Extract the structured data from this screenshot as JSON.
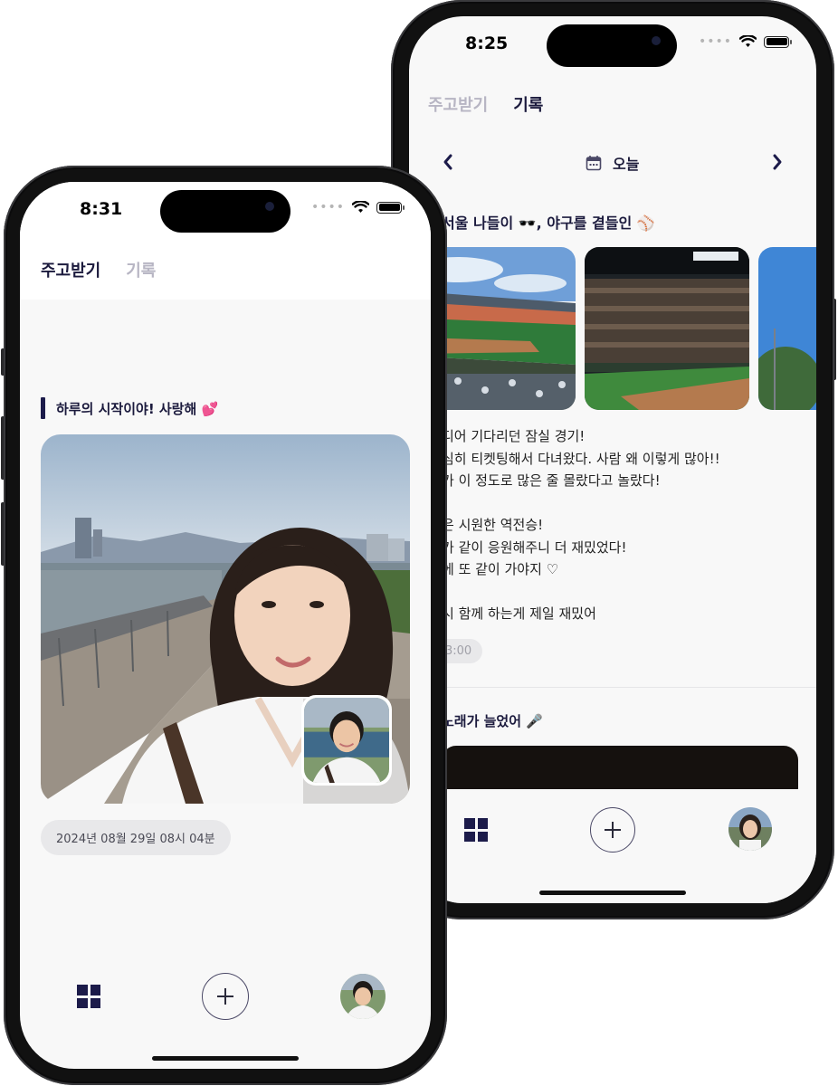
{
  "back_phone": {
    "status_time": "8:25",
    "tabs": {
      "give_receive": "주고받기",
      "records": "기록"
    },
    "date_nav": {
      "prev": "‹",
      "label": "오늘",
      "next": "›"
    },
    "post1": {
      "title": "서울 나들이 🕶️, 야구를 곁들인 ⚾",
      "lines": [
        "디어 기다리던 잠실 경기!",
        "심히 티켓팅해서 다녀왔다. 사람 왜 이렇게 많아!!",
        "가 이 정도로 많은 줄 몰랐다고 놀랐다!",
        "",
        "은 시원한 역전승!",
        "가 같이 응원해주니 더 재밌었다!",
        "에 또 같이 가야지 ♡",
        "",
        "시 함께 하는게 제일 재밌어"
      ],
      "time": "3:00"
    },
    "post2": {
      "title": "노래가 늘었어 🎤"
    }
  },
  "front_phone": {
    "status_time": "8:31",
    "tabs": {
      "give_receive": "주고받기",
      "records": "기록"
    },
    "post": {
      "title": "하루의 시작이야! 사랑해 💕",
      "timestamp": "2024년 08월 29일 08시 04분"
    }
  },
  "colors": {
    "accent": "#1c1b4a",
    "tab_inactive": "#b7b5c3",
    "screen_bg": "#f8f8f8",
    "pill_bg": "#e8e8ea"
  },
  "icons": [
    "grid-icon",
    "plus-icon",
    "calendar-icon",
    "wifi-icon",
    "battery-icon",
    "chevron-left-icon",
    "chevron-right-icon"
  ]
}
